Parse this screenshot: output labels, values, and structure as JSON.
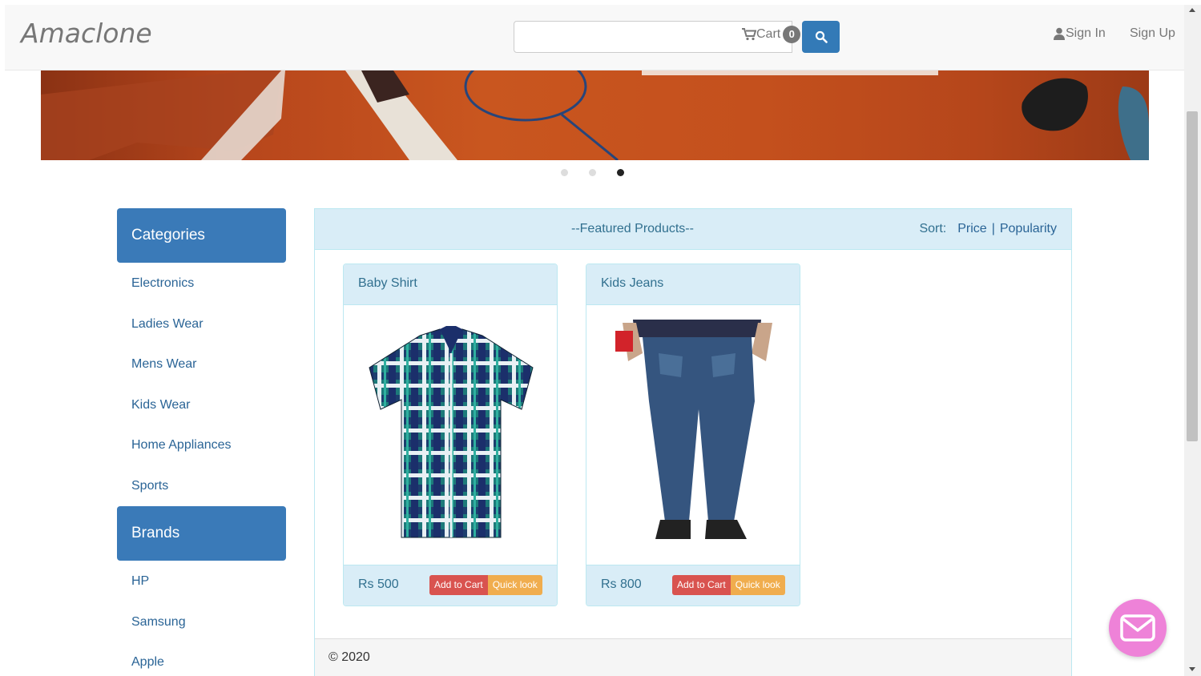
{
  "header": {
    "brand": "Amaclone",
    "search": {
      "placeholder": ""
    },
    "cart": {
      "label": "Cart",
      "count": "0"
    },
    "signin_label": "Sign In",
    "signup_label": "Sign Up"
  },
  "carousel": {
    "slides": 3,
    "active_index": 2
  },
  "sidebar": {
    "categories_title": "Categories",
    "categories": [
      "Electronics",
      "Ladies Wear",
      "Mens Wear",
      "Kids Wear",
      "Home Appliances",
      "Sports"
    ],
    "brands_title": "Brands",
    "brands": [
      "HP",
      "Samsung",
      "Apple"
    ]
  },
  "main": {
    "title": "--Featured Products--",
    "sort_label": "Sort:",
    "sort_options": [
      "Price",
      "Popularity"
    ],
    "sort_separator": "|",
    "products": [
      {
        "name": "Baby Shirt",
        "price": "Rs 500",
        "add_label": "Add to Cart",
        "quick_label": "Quick look"
      },
      {
        "name": "Kids Jeans",
        "price": "Rs 800",
        "add_label": "Add to Cart",
        "quick_label": "Quick look"
      }
    ]
  },
  "footer": {
    "copyright": "© 2020"
  },
  "colors": {
    "primary": "#337ab7",
    "panel_bg": "#d9edf7",
    "danger": "#d9534f",
    "warning": "#f0ad4e",
    "chat": "#ee82d8"
  },
  "icons": {
    "cart": "cart-icon",
    "search": "search-icon",
    "user": "user-icon",
    "chat": "mail-icon"
  }
}
